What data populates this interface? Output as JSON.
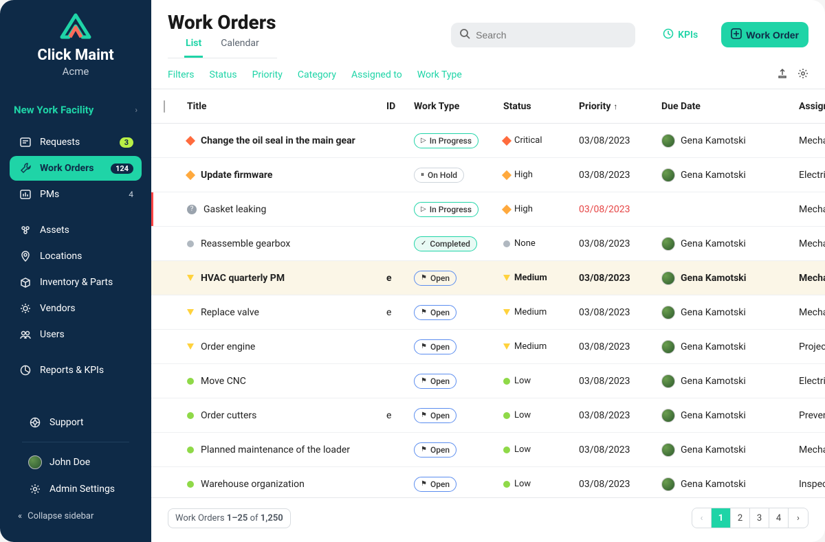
{
  "brand": {
    "name": "Click Maint",
    "tenant": "Acme"
  },
  "facility": {
    "name": "New York Facility"
  },
  "sidebar": {
    "items": [
      {
        "label": "Requests",
        "icon": "requests-icon",
        "badge": "3",
        "badgeType": "green"
      },
      {
        "label": "Work Orders",
        "icon": "wrench-icon",
        "badge": "124",
        "badgeType": "dark",
        "active": true
      },
      {
        "label": "PMs",
        "icon": "pms-icon",
        "badge": "4",
        "badgeType": "plain"
      }
    ],
    "items2": [
      {
        "label": "Assets",
        "icon": "assets-icon"
      },
      {
        "label": "Locations",
        "icon": "location-icon"
      },
      {
        "label": "Inventory & Parts",
        "icon": "box-icon"
      },
      {
        "label": "Vendors",
        "icon": "vendor-icon"
      },
      {
        "label": "Users",
        "icon": "users-icon"
      }
    ],
    "items3": [
      {
        "label": "Reports & KPIs",
        "icon": "chart-icon"
      }
    ],
    "items4": [
      {
        "label": "Support",
        "icon": "support-icon"
      }
    ],
    "items5": [
      {
        "label": "John Doe",
        "icon": "avatar-icon"
      },
      {
        "label": "Admin Settings",
        "icon": "gear-icon"
      }
    ],
    "collapse": "Collapse sidebar"
  },
  "header": {
    "title": "Work Orders",
    "search_placeholder": "Search",
    "kpis": "KPIs",
    "new_btn": "Work Order"
  },
  "tabs": [
    {
      "label": "List",
      "active": true
    },
    {
      "label": "Calendar",
      "active": false
    }
  ],
  "filters": [
    "Filters",
    "Status",
    "Priority",
    "Category",
    "Assigned to",
    "Work Type"
  ],
  "columns": {
    "title": "Title",
    "id": "ID",
    "work_type": "Work Type",
    "status": "Status",
    "priority": "Priority",
    "due": "Due Date",
    "assigned": "Assigned to"
  },
  "rows": [
    {
      "title": "Change the oil seal in the main gear",
      "id": "",
      "status": "In Progress",
      "statusClass": "progress",
      "statusIcon": "▷",
      "priority": "Critical",
      "prioClass": "critical",
      "due": "03/08/2023",
      "overdue": false,
      "assignee": "Gena Kamotski",
      "type": "Mechanical",
      "bold": true
    },
    {
      "title": "Update firmware",
      "id": "",
      "status": "On Hold",
      "statusClass": "",
      "statusIcon": "⏸",
      "priority": "High",
      "prioClass": "high",
      "due": "03/08/2023",
      "overdue": false,
      "assignee": "Gena Kamotski",
      "type": "Electric",
      "bold": true
    },
    {
      "title": "Gasket leaking",
      "id": "",
      "status": "In Progress",
      "statusClass": "progress",
      "statusIcon": "▷",
      "priority": "High",
      "prioClass": "high",
      "due": "03/08/2023",
      "overdue": true,
      "assignee": "",
      "type": "Mechanical",
      "redbar": true,
      "questionIcon": true
    },
    {
      "title": "Reassemble gearbox",
      "id": "",
      "status": "Completed",
      "statusClass": "completed",
      "statusIcon": "✓",
      "priority": "None",
      "prioClass": "none",
      "due": "03/08/2023",
      "overdue": false,
      "assignee": "Gena Kamotski",
      "type": "Mechanical"
    },
    {
      "title": "HVAC quarterly PM",
      "id": "e",
      "status": "Open",
      "statusClass": "open",
      "statusIcon": "⚑",
      "priority": "Medium",
      "prioClass": "medium",
      "due": "03/08/2023",
      "overdue": false,
      "assignee": "Gena Kamotski",
      "type": "Mechanical",
      "highlight": true,
      "bold": true
    },
    {
      "title": "Replace valve",
      "id": "e",
      "status": "Open",
      "statusClass": "open",
      "statusIcon": "⚑",
      "priority": "Medium",
      "prioClass": "medium",
      "due": "03/08/2023",
      "overdue": false,
      "assignee": "Gena Kamotski",
      "type": "Mechanical"
    },
    {
      "title": "Order engine",
      "id": "",
      "status": "Open",
      "statusClass": "open",
      "statusIcon": "⚑",
      "priority": "Medium",
      "prioClass": "medium",
      "due": "03/08/2023",
      "overdue": false,
      "assignee": "Gena Kamotski",
      "type": "Project"
    },
    {
      "title": "Move CNC",
      "id": "",
      "status": "Open",
      "statusClass": "open",
      "statusIcon": "⚑",
      "priority": "Low",
      "prioClass": "low",
      "due": "03/08/2023",
      "overdue": false,
      "assignee": "Gena Kamotski",
      "type": "Electrical"
    },
    {
      "title": "Order cutters",
      "id": "e",
      "status": "Open",
      "statusClass": "open",
      "statusIcon": "⚑",
      "priority": "Low",
      "prioClass": "low",
      "due": "03/08/2023",
      "overdue": false,
      "assignee": "Gena Kamotski",
      "type": "Preventive"
    },
    {
      "title": "Planned maintenance of the loader",
      "id": "",
      "status": "Open",
      "statusClass": "open",
      "statusIcon": "⚑",
      "priority": "Low",
      "prioClass": "low",
      "due": "03/08/2023",
      "overdue": false,
      "assignee": "Gena Kamotski",
      "type": "Mechanical"
    },
    {
      "title": "Warehouse organization",
      "id": "",
      "status": "Open",
      "statusClass": "open",
      "statusIcon": "⚑",
      "priority": "Low",
      "prioClass": "low",
      "due": "03/08/2023",
      "overdue": false,
      "assignee": "Gena Kamotski",
      "type": "Inspection"
    }
  ],
  "paging": {
    "label_prefix": "Work Orders ",
    "range": "1–25",
    "of": " of ",
    "total": "1,250",
    "pages": [
      "1",
      "2",
      "3",
      "4"
    ],
    "active": "1"
  }
}
